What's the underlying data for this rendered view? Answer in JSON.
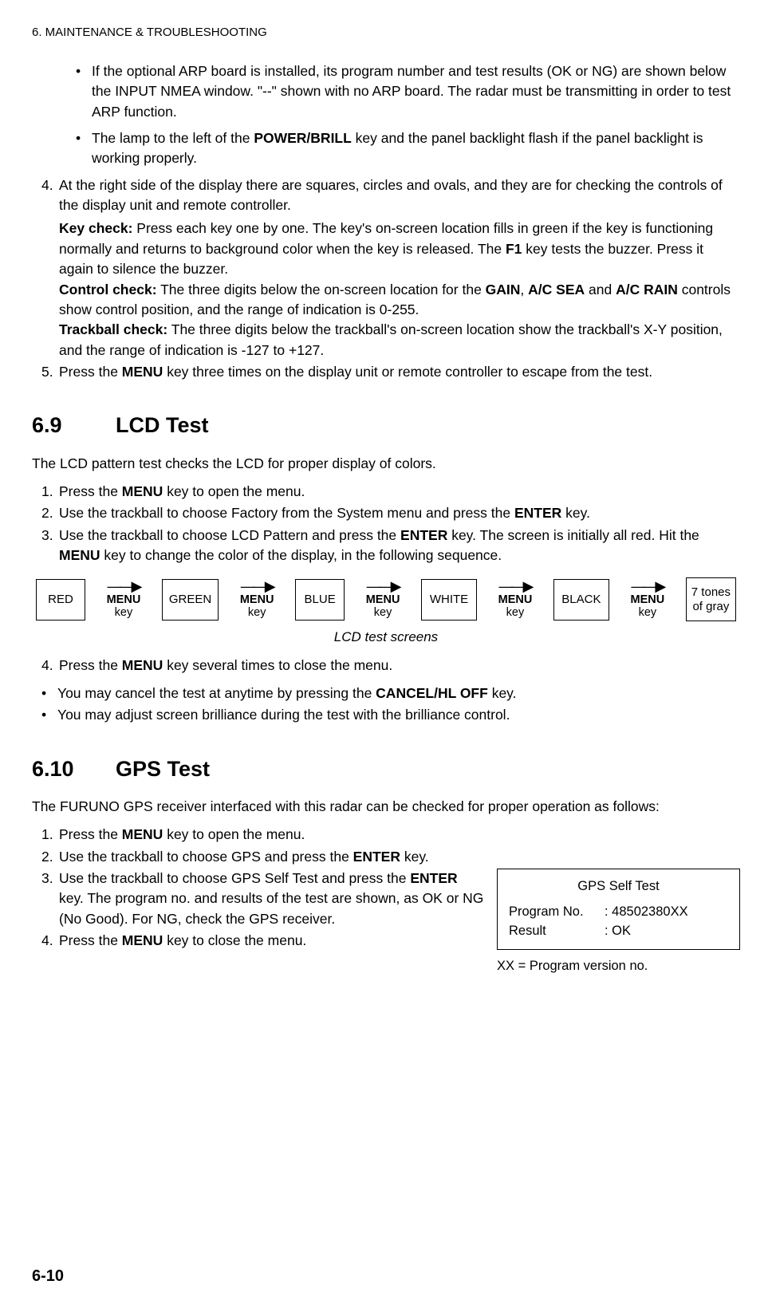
{
  "header": "6. MAINTENANCE & TROUBLESHOOTING",
  "intro_bullets": [
    {
      "pre": "If the optional ARP board is installed, its program number and test results (OK or NG) are shown below the INPUT NMEA window. \"--\" shown with no ARP board. The radar must be transmitting in order to test ARP function."
    },
    {
      "pre": "The lamp to the left of the ",
      "b1": "POWER/BRILL",
      "post": " key and the panel backlight flash if the panel backlight is working properly."
    }
  ],
  "intro_steps": {
    "s4": {
      "num": "4.",
      "p1": "At the right side of the display there are squares, circles and ovals, and they are for checking the controls of the display unit and remote controller.",
      "kc_label": "Key check:",
      "kc_t1": " Press each key one by one. The key's on-screen location fills in green if the key is functioning normally and returns to background color when the key is released. The ",
      "kc_b1": "F1",
      "kc_t2": " key tests the buzzer. Press it again to silence the buzzer.",
      "cc_label": "Control check:",
      "cc_t1": " The three digits below the on-screen location for the ",
      "cc_b1": "GAIN",
      "cc_t2": ", ",
      "cc_b2": "A/C SEA",
      "cc_t3": " and ",
      "cc_b3": "A/C RAIN",
      "cc_t4": " controls show control position, and the range of indication is 0-255.",
      "tc_label": "Trackball check:",
      "tc_t1": " The three digits below the trackball's on-screen location show the trackball's X-Y position, and the range of indication is -127 to +127."
    },
    "s5": {
      "num": "5.",
      "t1": "Press the ",
      "b1": "MENU",
      "t2": " key three times on the display unit or remote controller to escape from the test."
    }
  },
  "sec69": {
    "num": "6.9",
    "title": "LCD Test",
    "intro": "The LCD pattern test checks the LCD for proper display of colors.",
    "steps": {
      "s1": {
        "num": "1.",
        "t1": "Press the ",
        "b1": "MENU",
        "t2": " key to open the menu."
      },
      "s2": {
        "num": "2.",
        "t1": "Use the trackball to choose Factory from the System menu and press the ",
        "b1": "ENTER",
        "t2": " key."
      },
      "s3": {
        "num": "3.",
        "t1": "Use the trackball to choose LCD Pattern and press the ",
        "b1": "ENTER",
        "t2": " key. The screen is initially all red. Hit the ",
        "b2": "MENU",
        "t3": " key to change the color of the display, in the following sequence."
      },
      "s4": {
        "num": "4.",
        "t1": "Press the ",
        "b1": "MENU",
        "t2": " key several times to close the menu."
      }
    },
    "diagram": {
      "boxes": [
        "RED",
        "GREEN",
        "BLUE",
        "WHITE",
        "BLACK"
      ],
      "last_box_l1": "7 tones",
      "last_box_l2": "of gray",
      "menu_bold": "MENU",
      "menu_key": "key"
    },
    "caption": "LCD test screens",
    "notes": {
      "n1": {
        "t1": "You may cancel the test at anytime by pressing the ",
        "b1": "CANCEL/HL OFF",
        "t2": " key."
      },
      "n2": {
        "t1": "You may adjust screen brilliance during the test with the brilliance control."
      }
    }
  },
  "sec610": {
    "num": "6.10",
    "title": "GPS Test",
    "intro": "The FURUNO GPS receiver interfaced with this radar can be checked for proper operation as follows:",
    "steps": {
      "s1": {
        "num": "1.",
        "t1": "Press the ",
        "b1": "MENU",
        "t2": " key to open the menu."
      },
      "s2": {
        "num": "2.",
        "t1": "Use the trackball to choose GPS and press the ",
        "b1": "ENTER",
        "t2": " key."
      },
      "s3": {
        "num": "3.",
        "t1": "Use the trackball to choose GPS Self Test and press the ",
        "b1": "ENTER",
        "t2": " key. The program no. and results of the test are shown, as OK or NG (No Good). For NG, check the GPS receiver."
      },
      "s4": {
        "num": "4.",
        "t1": "Press the ",
        "b1": "MENU",
        "t2": " key to close the menu."
      }
    },
    "gps_box": {
      "title": "GPS Self Test",
      "row1_label": "Program No.",
      "row1_val": ": 48502380XX",
      "row2_label": "Result",
      "row2_val": ": OK"
    },
    "gps_note": "XX = Program version no."
  },
  "page_num": "6-10"
}
